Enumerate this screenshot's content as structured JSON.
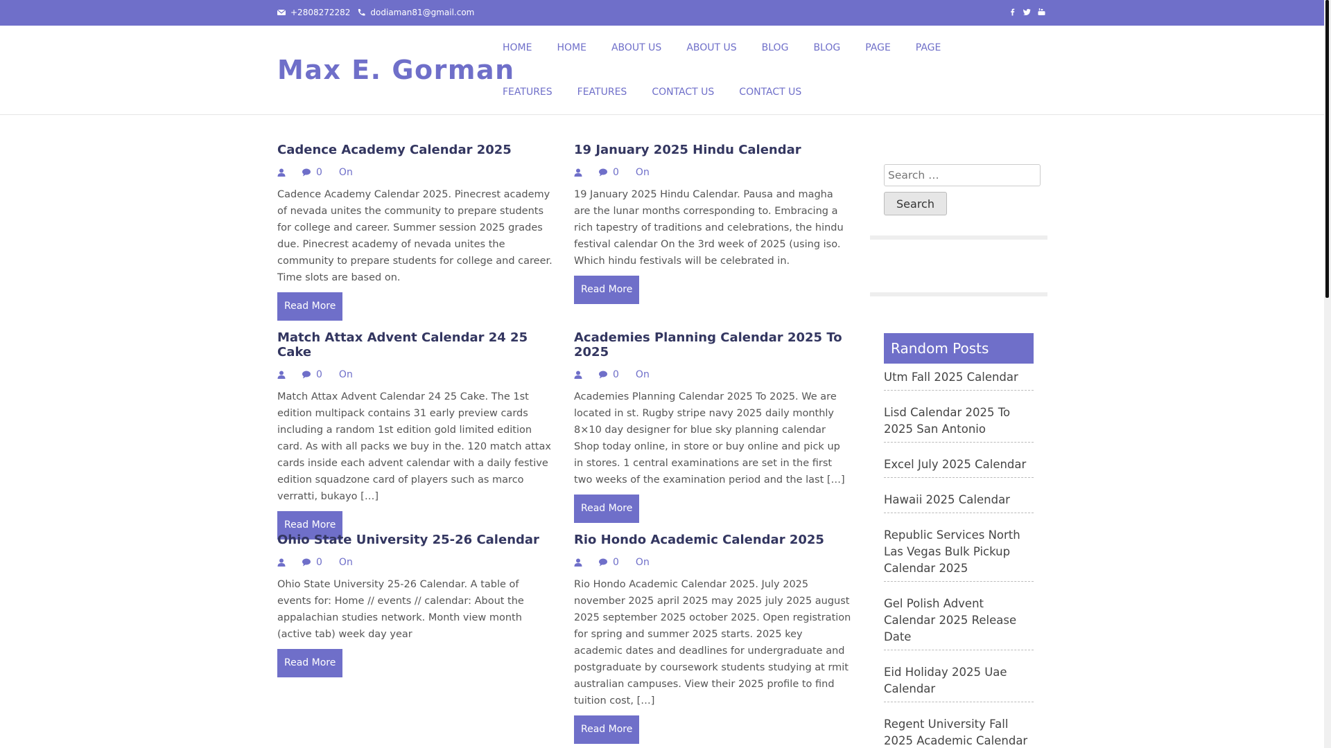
{
  "topbar": {
    "phone": "+2808272282",
    "email": "dodiaman81@gmail.com",
    "social_icons": [
      "facebook-icon",
      "twitter-icon",
      "youtube-icon"
    ]
  },
  "header": {
    "logo": "Max E. Gorman",
    "nav_row1": [
      "HOME",
      "HOME",
      "ABOUT US",
      "ABOUT US",
      "BLOG",
      "BLOG",
      "PAGE",
      "PAGE"
    ],
    "nav_row2": [
      "FEATURES",
      "FEATURES",
      "CONTACT US",
      "CONTACT US"
    ]
  },
  "posts": [
    {
      "title": "Cadence Academy Calendar 2025",
      "comments": "0",
      "on": "On",
      "excerpt": "Cadence Academy Calendar 2025. Pinecrest academy of nevada unites the community to prepare students for college and career. Summer session 2025 grades due. Pinecrest academy of nevada unites the community to prepare students for college and career. Time slots are based on.",
      "button": "Read More"
    },
    {
      "title": "19 January 2025 Hindu Calendar",
      "comments": "0",
      "on": "On",
      "excerpt": "19 January 2025 Hindu Calendar. Pausa and magha are the lunar months corresponding to. Embracing a rich tapestry of traditions and celebrations, the hindu festival calendar On the 3rd week of 2025 (using iso. Which hindu festivals will be celebrated in.",
      "button": "Read More"
    },
    {
      "title": "Match Attax Advent Calendar 24 25 Cake",
      "comments": "0",
      "on": "On",
      "excerpt": "Match Attax Advent Calendar 24 25 Cake. The 1st edition multipack contains 31 early preview cards including a random 1st edition gold limited edition card. As with all packs we buy in the. 120 match attax cards inside each advent calendar with a daily festive edition squadzone card of players such as marco verratti, bukayo […]",
      "button": "Read More"
    },
    {
      "title": "Academies Planning Calendar 2025 To 2025",
      "comments": "0",
      "on": "On",
      "excerpt": "Academies Planning Calendar 2025 To 2025. We are located in st. Rugby stripe navy 2025 daily monthly 8×10 day designer for blue sky planning calendar Shop today online, in store or buy online and pick up in stores. 1 central examinations are set in the first two weeks of the examination period and the last […]",
      "button": "Read More"
    },
    {
      "title": "Ohio State University 25-26 Calendar",
      "comments": "0",
      "on": "On",
      "excerpt": "Ohio State University 25-26 Calendar. A table of events for: Home // events // calendar: About the appalachian studies network. Month view month (active tab) week day year",
      "button": "Read More"
    },
    {
      "title": "Rio Hondo Academic Calendar 2025",
      "comments": "0",
      "on": "On",
      "excerpt": "Rio Hondo Academic Calendar 2025. July 2025 november 2025 april 2025 may 2025 july 2025 august 2025 september 2025 october 2025. Open registration for spring and summer 2025 starts. 2025 key academic dates and deadlines for undergraduate and postgraduate by coursework students studying at rmit australian campuses. View their 2025 profile to find tuition cost, […]",
      "button": "Read More"
    }
  ],
  "sidebar": {
    "search_placeholder": "Search …",
    "search_button": "Search",
    "random_title": "Random Posts",
    "random_posts": [
      "Utm Fall 2025 Calendar",
      "Lisd Calendar 2025 To 2025 San Antonio",
      "Excel July 2025 Calendar",
      "Hawaii 2025 Calendar",
      "Republic Services North Las Vegas Bulk Pickup Calendar 2025",
      "Gel Polish Advent Calendar 2025 Release Date",
      "Eid Holiday 2025 Uae Calendar",
      "Regent University Fall 2025 Academic Calendar"
    ]
  },
  "colors": {
    "accent": "#6f6fc9",
    "title": "#333660"
  }
}
